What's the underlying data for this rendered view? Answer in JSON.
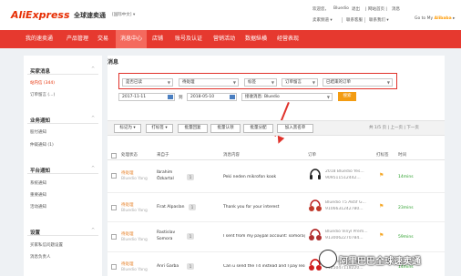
{
  "header": {
    "logo": "AliExpress",
    "logo_sub": "全球速卖通",
    "language": "[国际中文] ▾",
    "greeting": "欢迎您，",
    "user": "Bluedio",
    "logout": "退出",
    "links_top": [
      "| 网站首页 |",
      "消息"
    ],
    "links_bottom": [
      "卖家频道 ▾",
      "联系客服",
      "联系我们 ▾"
    ],
    "go_to": "Go to My",
    "go_brand": "Alibaba",
    "go_arrow": "▸"
  },
  "nav": {
    "items": [
      "我的速卖通",
      "产品管理",
      "交易",
      "消息中心",
      "店铺",
      "账号及认证",
      "营销活动",
      "数据纵横",
      "经营表现"
    ],
    "active_index": 3
  },
  "sidebar": {
    "sections": [
      {
        "title": "买家消息",
        "items": [
          "站内信 (344)",
          "订单留言 (...)"
        ],
        "active_item": 0
      },
      {
        "title": "业务通知",
        "items": [
          "股付通知",
          "仲裁通知 (1)"
        ]
      },
      {
        "title": "平台通知",
        "items": [
          "系统通知",
          "重要通知",
          "活动通知"
        ]
      },
      {
        "title": "设置",
        "items": [
          "买家私信问题设置",
          "消息负责人"
        ]
      }
    ]
  },
  "main": {
    "title": "消息",
    "filters": {
      "selects": [
        "是否已读",
        "待处理",
        "标签",
        "订单留言",
        "已结束的订单"
      ],
      "date_from": "2017-11-11",
      "date_to": "2018-05-10",
      "date_sep": "到",
      "contact_select": "接收消息: Bluedio",
      "search_button": "搜索"
    },
    "toolbar": {
      "buttons": [
        "标记为 ▾",
        "打标签 ▾",
        "批量回复",
        "批量认领",
        "批量分配",
        "加入黑名单"
      ],
      "pager": "共 1/5 页 | 上一页 | 下一页"
    },
    "table": {
      "headers": [
        "处理状态",
        "来自于",
        "消息内容",
        "订单",
        "打标签",
        "时间"
      ],
      "rows": [
        {
          "status": "待处理",
          "owner": "Bluedio Yang",
          "from": [
            "Ibrahim",
            "Özkartal"
          ],
          "count": "1",
          "message": "Peki neden mikrofon kook",
          "product": [
            "2018 Bluedio Yes...",
            "909511512442..."
          ],
          "time": "14mins"
        },
        {
          "status": "待处理",
          "owner": "Bluedio Yang",
          "from": [
            "Firat Alpaslan"
          ],
          "count": "1",
          "message": "Thank you for your interest",
          "product": [
            "Bluedio T5 Aktif G...",
            "9106631242780..."
          ],
          "time": "23mins"
        },
        {
          "status": "待处理",
          "owner": "Bluedio Yang",
          "from": [
            "Rastislav",
            "Somora"
          ],
          "count": "1",
          "message": "I sent from my paypal account: somora@...",
          "product": [
            "Bluedio Vinyl Prem...",
            "9130062270784..."
          ],
          "time": "59mins"
        },
        {
          "status": "待处理",
          "owner": "Bluedio Yang",
          "from": [
            "Anri Garba"
          ],
          "count": "1",
          "message": "Can u send the T4 instead and I pay less?",
          "product": [
            "Bluedio T6 Active...",
            "9125047118220..."
          ],
          "time": "14mins"
        }
      ]
    }
  },
  "watermark": {
    "text": "阿里巴巴全球速卖通"
  },
  "colors": {
    "brand": "#e62e04",
    "nav": "#e6392f",
    "accent": "#f39c12",
    "highlight": "#e0322b"
  }
}
